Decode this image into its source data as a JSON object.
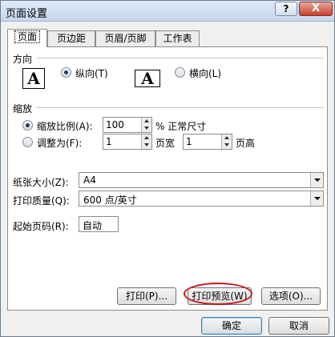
{
  "window": {
    "title": "页面设置",
    "help_glyph": "?",
    "close_glyph": "X"
  },
  "tabs": [
    {
      "label": "页面",
      "active": true
    },
    {
      "label": "页边距",
      "active": false
    },
    {
      "label": "页眉/页脚",
      "active": false
    },
    {
      "label": "工作表",
      "active": false
    }
  ],
  "orientation": {
    "group_label": "方向",
    "portrait_label": "纵向(T)",
    "landscape_label": "横向(L)",
    "selected": "portrait",
    "icon_letter": "A"
  },
  "scaling": {
    "group_label": "缩放",
    "scale_label": "缩放比例(A):",
    "scale_value": "100",
    "scale_unit": "% 正常尺寸",
    "fit_label": "调整为(F):",
    "pages_wide_value": "1",
    "pages_wide_label": "页宽",
    "pages_tall_value": "1",
    "pages_tall_label": "页高",
    "selected": "scale"
  },
  "paper": {
    "size_label": "纸张大小(Z):",
    "size_value": "A4",
    "quality_label": "打印质量(Q):",
    "quality_value": "600 点/英寸"
  },
  "first_page": {
    "label": "起始页码(R):",
    "value": "自动"
  },
  "buttons": {
    "print": "打印(P)...",
    "preview": "打印预览(W)",
    "options": "选项(O)...",
    "ok": "确定",
    "cancel": "取消"
  },
  "colors": {
    "highlight_ring": "#c21818",
    "title_gradient_top": "#dfeaf7",
    "close_button": "#c8422e"
  }
}
